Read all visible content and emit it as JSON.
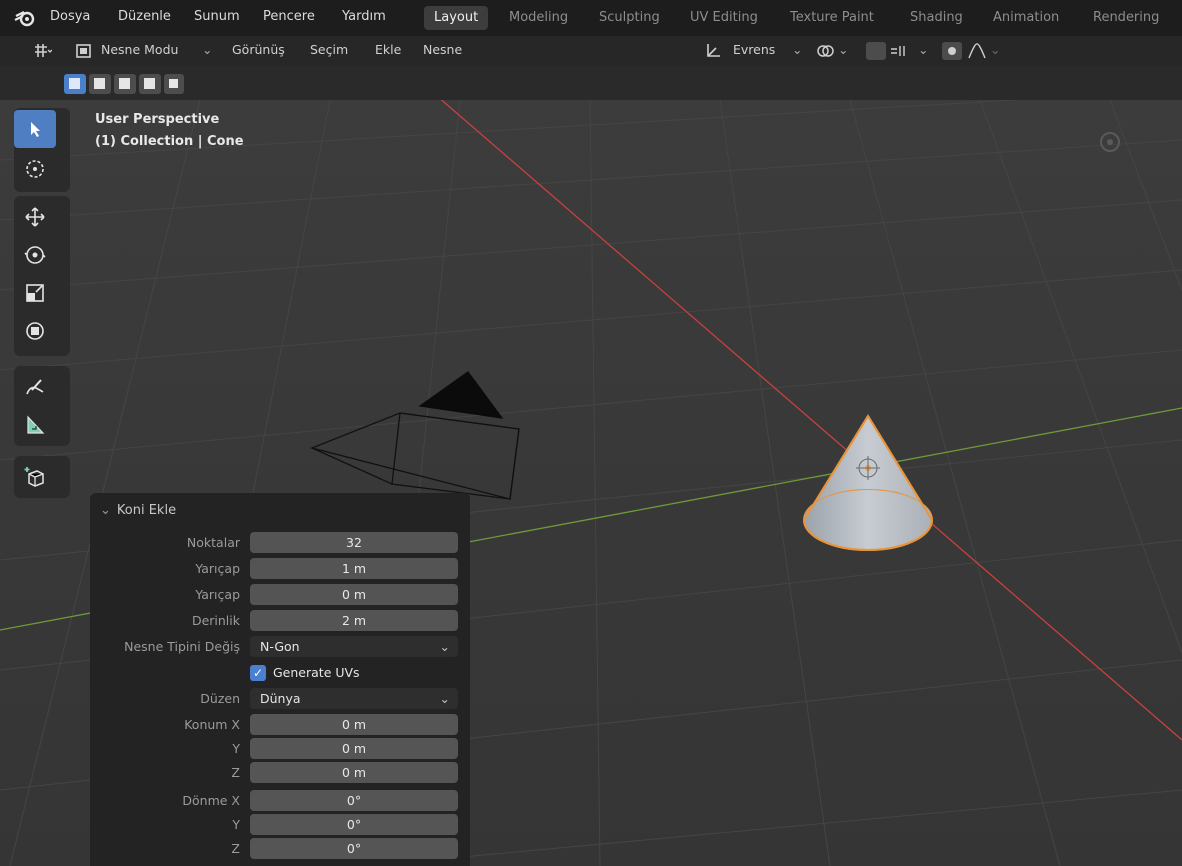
{
  "menu": [
    "Dosya",
    "Düzenle",
    "Sunum",
    "Pencere",
    "Yardım"
  ],
  "workspaces": [
    "Layout",
    "Modeling",
    "Sculpting",
    "UV Editing",
    "Texture Paint",
    "Shading",
    "Animation",
    "Rendering"
  ],
  "header": {
    "mode": "Nesne Modu",
    "view": "Görünüş",
    "select": "Seçim",
    "add": "Ekle",
    "object": "Nesne",
    "orientation": "Evrens"
  },
  "viewport_info": {
    "line1": "User Perspective",
    "line2": "(1) Collection | Cone"
  },
  "panel": {
    "title": "Koni Ekle",
    "rows": [
      {
        "label": "Noktalar",
        "value": "32"
      },
      {
        "label": "Yarıçap",
        "value": "1 m"
      },
      {
        "label": "Yarıçap",
        "value": "0 m"
      },
      {
        "label": "Derinlik",
        "value": "2 m"
      }
    ],
    "type_label": "Nesne Tipini Değiş",
    "type_value": "N-Gon",
    "uv_label": "Generate UVs",
    "align_label": "Düzen",
    "align_value": "Dünya",
    "location": {
      "label_x": "Konum X",
      "label_y": "Y",
      "label_z": "Z",
      "x": "0 m",
      "y": "0 m",
      "z": "0 m"
    },
    "rotation": {
      "label_x": "Dönme X",
      "label_y": "Y",
      "label_z": "Z",
      "x": "0°",
      "y": "0°",
      "z": "0°"
    }
  },
  "colors": {
    "accent": "#4f7ec2",
    "selection_outline": "#e8943a",
    "x_axis": "#c8413e",
    "y_axis": "#6e9a3a"
  }
}
